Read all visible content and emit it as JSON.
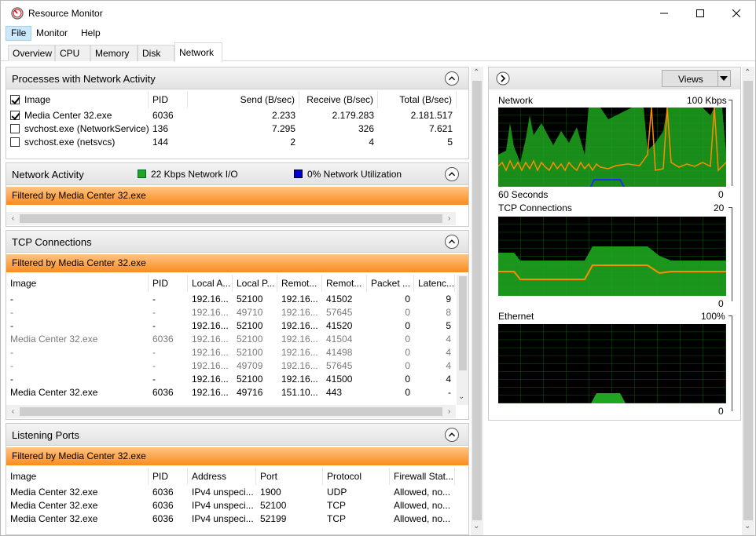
{
  "window": {
    "title": "Resource Monitor"
  },
  "menu": [
    "File",
    "Monitor",
    "Help"
  ],
  "tabs": [
    "Overview",
    "CPU",
    "Memory",
    "Disk",
    "Network"
  ],
  "processes": {
    "title": "Processes with Network Activity",
    "columns": [
      "Image",
      "PID",
      "Send (B/sec)",
      "Receive (B/sec)",
      "Total (B/sec)"
    ],
    "rows": [
      {
        "image": "Media Center 32.exe",
        "pid": "6036",
        "send": "2.233",
        "receive": "2.179.283",
        "total": "2.181.517",
        "checked": true
      },
      {
        "image": "svchost.exe (NetworkService)",
        "pid": "136",
        "send": "7.295",
        "receive": "326",
        "total": "7.621",
        "checked": false
      },
      {
        "image": "svchost.exe (netsvcs)",
        "pid": "144",
        "send": "2",
        "receive": "4",
        "total": "5",
        "checked": false
      }
    ]
  },
  "network_activity": {
    "title": "Network Activity",
    "io": "22 Kbps Network I/O",
    "util": "0% Network Utilization",
    "filter": "Filtered by Media Center 32.exe",
    "io_color": "#1fa51f",
    "util_color": "#0000cc"
  },
  "tcp": {
    "title": "TCP Connections",
    "filter": "Filtered by Media Center 32.exe",
    "columns": [
      "Image",
      "PID",
      "Local A...",
      "Local P...",
      "Remot...",
      "Remot...",
      "Packet ...",
      "Latenc..."
    ],
    "rows": [
      {
        "image": "-",
        "pid": "-",
        "la": "192.16...",
        "lp": "52100",
        "ra": "192.16...",
        "rp": "41502",
        "pl": "0",
        "lat": "9",
        "dim": false
      },
      {
        "image": "-",
        "pid": "-",
        "la": "192.16...",
        "lp": "49710",
        "ra": "192.16...",
        "rp": "57645",
        "pl": "0",
        "lat": "8",
        "dim": true
      },
      {
        "image": "-",
        "pid": "-",
        "la": "192.16...",
        "lp": "52100",
        "ra": "192.16...",
        "rp": "41520",
        "pl": "0",
        "lat": "5",
        "dim": false
      },
      {
        "image": "Media Center 32.exe",
        "pid": "6036",
        "la": "192.16...",
        "lp": "52100",
        "ra": "192.16...",
        "rp": "41504",
        "pl": "0",
        "lat": "4",
        "dim": true
      },
      {
        "image": "-",
        "pid": "-",
        "la": "192.16...",
        "lp": "52100",
        "ra": "192.16...",
        "rp": "41498",
        "pl": "0",
        "lat": "4",
        "dim": true
      },
      {
        "image": "-",
        "pid": "-",
        "la": "192.16...",
        "lp": "49709",
        "ra": "192.16...",
        "rp": "57645",
        "pl": "0",
        "lat": "4",
        "dim": true
      },
      {
        "image": "-",
        "pid": "-",
        "la": "192.16...",
        "lp": "52100",
        "ra": "192.16...",
        "rp": "41500",
        "pl": "0",
        "lat": "4",
        "dim": false
      },
      {
        "image": "Media Center 32.exe",
        "pid": "6036",
        "la": "192.16...",
        "lp": "49716",
        "ra": "151.10...",
        "rp": "443",
        "pl": "0",
        "lat": "-",
        "dim": false
      }
    ]
  },
  "listening": {
    "title": "Listening Ports",
    "filter": "Filtered by Media Center 32.exe",
    "columns": [
      "Image",
      "PID",
      "Address",
      "Port",
      "Protocol",
      "Firewall Stat..."
    ],
    "rows": [
      {
        "image": "Media Center 32.exe",
        "pid": "6036",
        "addr": "IPv4 unspeci...",
        "port": "1900",
        "proto": "UDP",
        "fw": "Allowed, no..."
      },
      {
        "image": "Media Center 32.exe",
        "pid": "6036",
        "addr": "IPv4 unspeci...",
        "port": "52100",
        "proto": "TCP",
        "fw": "Allowed, no..."
      },
      {
        "image": "Media Center 32.exe",
        "pid": "6036",
        "addr": "IPv4 unspeci...",
        "port": "52199",
        "proto": "TCP",
        "fw": "Allowed, no..."
      }
    ]
  },
  "graphs": {
    "views": "Views",
    "network": {
      "title": "Network",
      "max": "100 Kbps",
      "bottom_left": "60 Seconds",
      "bottom_right": "0"
    },
    "tcp": {
      "title": "TCP Connections",
      "max": "20",
      "bottom_right": "0"
    },
    "ethernet": {
      "title": "Ethernet",
      "max": "100%",
      "bottom_right": "0"
    }
  }
}
